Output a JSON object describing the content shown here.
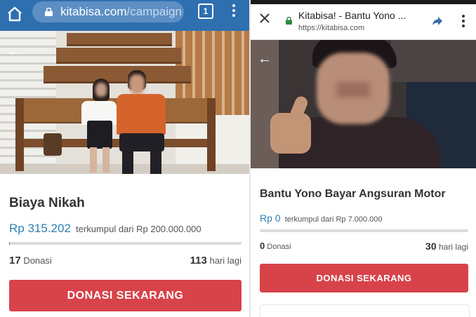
{
  "left": {
    "url_domain": "kitabisa.com",
    "url_path": "/campaign",
    "tab_count": "1",
    "campaign_title": "Biaya Nikah",
    "raised_amount": "Rp 315.202",
    "raised_text": "terkumpul dari Rp 200.000.000",
    "progress_percent": 0.16,
    "donations_count": "17",
    "donations_label": "Donasi",
    "days_count": "113",
    "days_label": "hari lagi",
    "donate_button": "DONASI SEKARANG"
  },
  "right": {
    "page_title": "Kitabisa! - Bantu Yono ...",
    "url": "https://kitabisa.com",
    "campaign_title": "Bantu Yono Bayar Angsuran Motor",
    "raised_amount": "Rp 0",
    "raised_text": "terkumpul dari Rp 7.000.000",
    "progress_percent": 0,
    "donations_count": "0",
    "donations_label": "Donasi",
    "days_count": "30",
    "days_label": "hari lagi",
    "donate_button": "DONASI SEKARANG"
  },
  "colors": {
    "browser_bar": "#2e6fb0",
    "donate_button": "#d8434a",
    "amount": "#2e7fb3"
  }
}
